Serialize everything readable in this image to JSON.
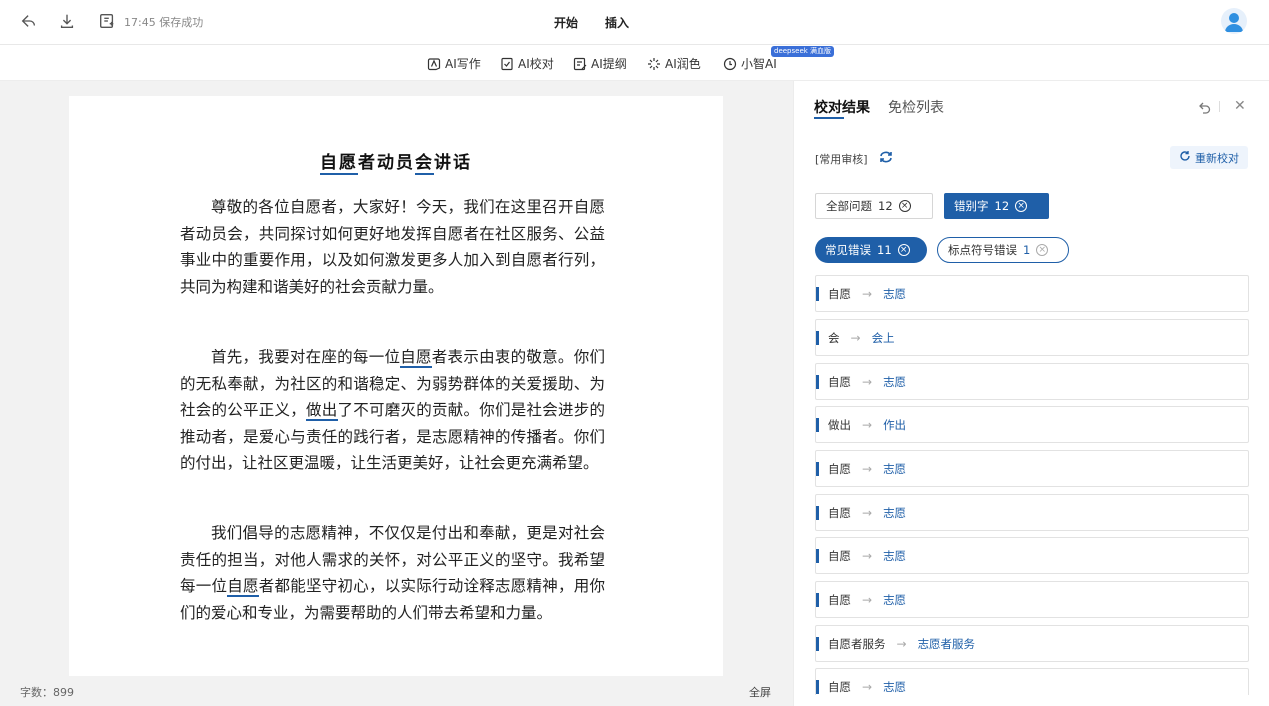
{
  "header": {
    "save_status": "17:45 保存成功",
    "tabs": [
      "开始",
      "插入"
    ]
  },
  "toolbar": {
    "items": [
      "AI写作",
      "AI校对",
      "AI提纲",
      "AI润色",
      "小智AI"
    ],
    "badge": "deepseek 满血版"
  },
  "document": {
    "title": "自愿者动员会讲话",
    "paragraphs": [
      "尊敬的各位自愿者，大家好！今天，我们在这里召开自愿者动员会，共同探讨如何更好地发挥自愿者在社区服务、公益事业中的重要作用，以及如何激发更多人加入到自愿者行列，共同为构建和谐美好的社会贡献力量。",
      "首先，我要对在座的每一位自愿者表示由衷的敬意。你们的无私奉献，为社区的和谐稳定、为弱势群体的关爱援助、为社会的公平正义，做出了不可磨灭的贡献。你们是社会进步的推动者，是爱心与责任的践行者，是志愿精神的传播者。你们的付出，让社区更温暖，让生活更美好，让社会更充满希望。",
      "我们倡导的志愿精神，不仅仅是付出和奉献，更是对社会责任的担当，对他人需求的关怀，对公平正义的坚守。我希望每一位自愿者都能坚守初心，以实际行动诠释志愿精神，用你们的爱心和专业，为需要帮助的人们带去希望和力量。"
    ]
  },
  "status": {
    "word_count": "字数：899",
    "fullscreen": "全屏"
  },
  "panel": {
    "tab_active": "校对结果",
    "tab_other": "免检列表",
    "audit_label": "[常用审核]",
    "recheck": "重新校对",
    "filters": {
      "all": "全部问题",
      "all_count": "12",
      "typo": "错别字",
      "typo_count": "12",
      "common": "常见错误",
      "common_count": "11",
      "punct": "标点符号错误",
      "punct_count": "1"
    },
    "errors": [
      {
        "from": "自愿",
        "to": "志愿"
      },
      {
        "from": "会",
        "to": "会上"
      },
      {
        "from": "自愿",
        "to": "志愿"
      },
      {
        "from": "做出",
        "to": "作出"
      },
      {
        "from": "自愿",
        "to": "志愿"
      },
      {
        "from": "自愿",
        "to": "志愿"
      },
      {
        "from": "自愿",
        "to": "志愿"
      },
      {
        "from": "自愿",
        "to": "志愿"
      },
      {
        "from": "自愿者服务",
        "to": "志愿者服务"
      },
      {
        "from": "自愿",
        "to": "志愿"
      }
    ]
  },
  "colors": {
    "accent": "#1f5fa8",
    "editor_bg": "#f2f2f2"
  }
}
